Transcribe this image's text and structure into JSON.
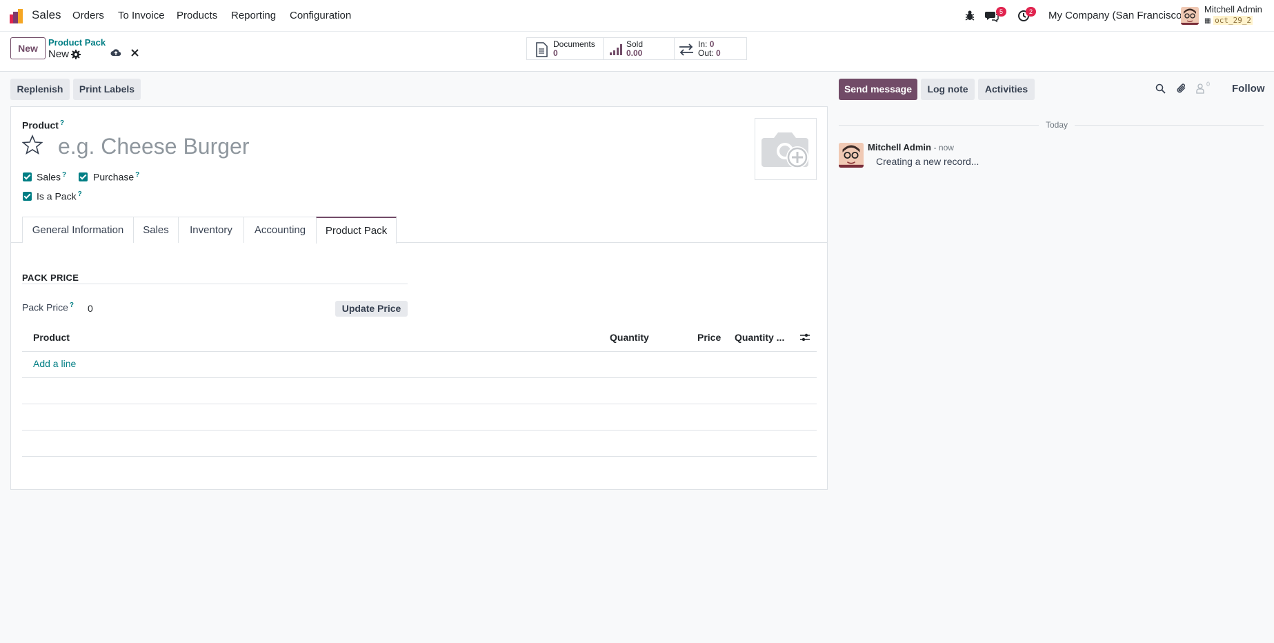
{
  "navbar": {
    "app_name": "Sales",
    "menu": [
      "Orders",
      "To Invoice",
      "Products",
      "Reporting",
      "Configuration"
    ],
    "messages_count": "5",
    "activities_count": "2",
    "company": "My Company (San Francisco)",
    "user_name": "Mitchell Admin",
    "db_name": "oct_29_2"
  },
  "control": {
    "new_label": "New",
    "breadcrumb_parent": "Product Pack",
    "breadcrumb_current": "New",
    "stats": {
      "documents_label": "Documents",
      "documents_value": "0",
      "sold_label": "Sold",
      "sold_value": "0.00",
      "in_label": "In:",
      "in_value": "0",
      "out_label": "Out:",
      "out_value": "0"
    }
  },
  "actions": {
    "replenish": "Replenish",
    "print_labels": "Print Labels",
    "send_message": "Send message",
    "log_note": "Log note",
    "activities": "Activities",
    "followers_count": "0",
    "follow": "Follow"
  },
  "form": {
    "product_label": "Product",
    "help_mark": "?",
    "name_placeholder": "e.g. Cheese Burger",
    "checkboxes": {
      "sales": "Sales",
      "purchase": "Purchase",
      "is_pack": "Is a Pack"
    },
    "tabs": [
      "General Information",
      "Sales",
      "Inventory",
      "Accounting",
      "Product Pack"
    ],
    "active_tab": "Product Pack",
    "section_title": "PACK PRICE",
    "pack_price_label": "Pack Price",
    "pack_price_value": "0",
    "update_price": "Update Price",
    "columns": [
      "Product",
      "Quantity",
      "Price",
      "Quantity ..."
    ],
    "add_line": "Add a line"
  },
  "chatter": {
    "date_separator": "Today",
    "author": "Mitchell Admin",
    "time": "- now",
    "body": "Creating a new record..."
  },
  "colors": {
    "brand": "#714b67",
    "accent": "#017e84",
    "badge": "#e0234e"
  }
}
